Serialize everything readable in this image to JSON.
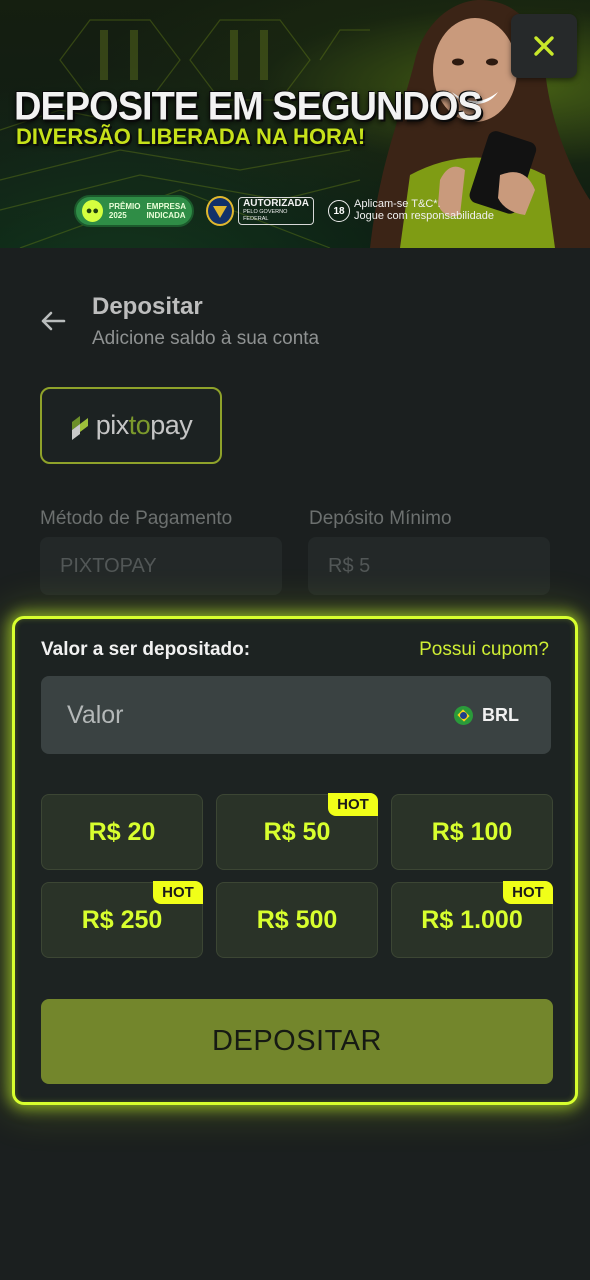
{
  "banner": {
    "headline": "DEPOSITE EM SEGUNDOS",
    "subheadline": "DIVERSÃO LIBERADA NA HORA!",
    "badge_premio_line1": "PRÊMIO",
    "badge_premio_line2": "2025",
    "badge_premio_line3": "EMPRESA",
    "badge_premio_line4": "INDICADA",
    "badge_autorizada": "AUTORIZADA",
    "badge_autorizada_sub": "PELO GOVERNO FEDERAL",
    "age_badge": "18",
    "responsible_line1": "Aplicam-se T&C*.",
    "responsible_line2": "Jogue com responsabilidade"
  },
  "header": {
    "title": "Depositar",
    "subtitle": "Adicione saldo à sua conta"
  },
  "payment_provider": {
    "name_part1": "pix",
    "name_part2": "to",
    "name_part3": "pay"
  },
  "fields": {
    "method_label": "Método de Pagamento",
    "method_value": "PIXTOPAY",
    "min_label": "Depósito Mínimo",
    "min_value": "R$ 5"
  },
  "deposit": {
    "amount_label": "Valor a ser depositado:",
    "coupon_link": "Possui cupom?",
    "amount_placeholder": "Valor",
    "currency": "BRL",
    "presets": [
      {
        "label": "R$ 20",
        "hot": false
      },
      {
        "label": "R$ 50",
        "hot": true
      },
      {
        "label": "R$ 100",
        "hot": false
      },
      {
        "label": "R$ 250",
        "hot": true
      },
      {
        "label": "R$ 500",
        "hot": false
      },
      {
        "label": "R$ 1.000",
        "hot": true
      }
    ],
    "hot_label": "HOT",
    "submit_label": "DEPOSITAR"
  },
  "colors": {
    "accent": "#d8ff2e",
    "button_bg": "#73862c",
    "background": "#1b1f1f"
  }
}
